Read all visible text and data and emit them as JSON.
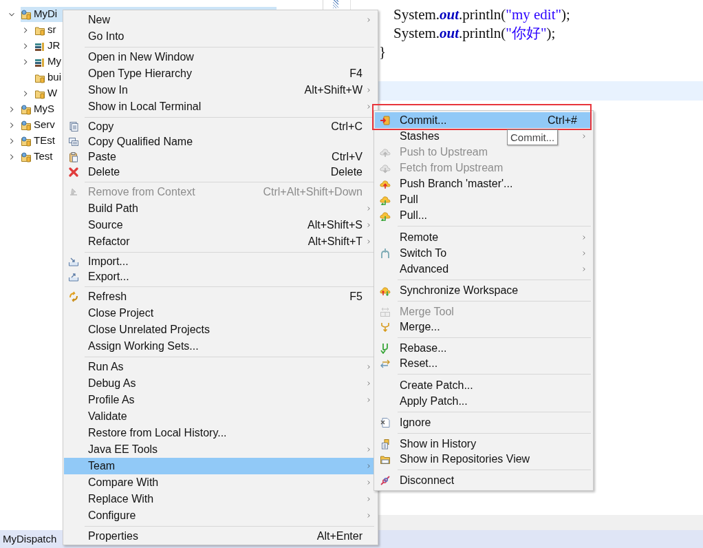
{
  "tree": {
    "items": [
      {
        "label": "MyDi",
        "expanded": true,
        "selected": true,
        "children": [
          {
            "label": "sr",
            "expanded": false,
            "selected": false
          },
          {
            "label": "JR",
            "expanded": false,
            "selected": false
          },
          {
            "label": "My",
            "expanded": false,
            "selected": false
          },
          {
            "label": "bui",
            "selected": false
          },
          {
            "label": "W",
            "expanded": false,
            "selected": false
          }
        ]
      },
      {
        "label": "MyS",
        "expanded": false,
        "selected": false
      },
      {
        "label": "Serv",
        "expanded": false,
        "selected": false
      },
      {
        "label": "TEst",
        "expanded": false,
        "selected": false
      },
      {
        "label": "Test",
        "expanded": false,
        "selected": false
      }
    ]
  },
  "editor": {
    "lines": [
      [
        {
          "kind": "plain",
          "text": "\tSystem."
        },
        {
          "kind": "field",
          "text": "out"
        },
        {
          "kind": "plain",
          "text": ".println("
        },
        {
          "kind": "string",
          "text": "\"my edit\""
        },
        {
          "kind": "plain",
          "text": ");"
        }
      ],
      [
        {
          "kind": "plain",
          "text": "\tSystem."
        },
        {
          "kind": "field",
          "text": "out"
        },
        {
          "kind": "plain",
          "text": ".println("
        },
        {
          "kind": "string",
          "text": "\"你好\""
        },
        {
          "kind": "plain",
          "text": ");"
        }
      ],
      [
        {
          "kind": "plain",
          "text": "}"
        }
      ]
    ]
  },
  "context_menu": {
    "groups": [
      [
        {
          "label": "New",
          "submenu": true,
          "disabled": false,
          "selected": false
        },
        {
          "label": "Go Into",
          "submenu": false,
          "disabled": false,
          "selected": false
        }
      ],
      [
        {
          "label": "Open in New Window",
          "submenu": false,
          "disabled": false,
          "selected": false
        },
        {
          "label": "Open Type Hierarchy",
          "shortcut": "F4",
          "submenu": false,
          "disabled": false,
          "selected": false
        },
        {
          "label": "Show In",
          "shortcut": "Alt+Shift+W",
          "submenu": true,
          "disabled": false,
          "selected": false
        },
        {
          "label": "Show in Local Terminal",
          "submenu": true,
          "disabled": false,
          "selected": false
        }
      ],
      [
        {
          "label": "Copy",
          "shortcut": "Ctrl+C",
          "submenu": false,
          "disabled": false,
          "selected": false
        },
        {
          "label": "Copy Qualified Name",
          "submenu": false,
          "disabled": false,
          "selected": false
        },
        {
          "label": "Paste",
          "shortcut": "Ctrl+V",
          "submenu": false,
          "disabled": false,
          "selected": false
        },
        {
          "label": "Delete",
          "shortcut": "Delete",
          "submenu": false,
          "disabled": false,
          "selected": false
        }
      ],
      [
        {
          "label": "Remove from Context",
          "shortcut": "Ctrl+Alt+Shift+Down",
          "submenu": false,
          "disabled": true,
          "selected": false
        },
        {
          "label": "Build Path",
          "submenu": true,
          "disabled": false,
          "selected": false
        },
        {
          "label": "Source",
          "shortcut": "Alt+Shift+S",
          "submenu": true,
          "disabled": false,
          "selected": false
        },
        {
          "label": "Refactor",
          "shortcut": "Alt+Shift+T",
          "submenu": true,
          "disabled": false,
          "selected": false
        }
      ],
      [
        {
          "label": "Import...",
          "submenu": false,
          "disabled": false,
          "selected": false
        },
        {
          "label": "Export...",
          "submenu": false,
          "disabled": false,
          "selected": false
        }
      ],
      [
        {
          "label": "Refresh",
          "shortcut": "F5",
          "submenu": false,
          "disabled": false,
          "selected": false
        },
        {
          "label": "Close Project",
          "submenu": false,
          "disabled": false,
          "selected": false
        },
        {
          "label": "Close Unrelated Projects",
          "submenu": false,
          "disabled": false,
          "selected": false
        },
        {
          "label": "Assign Working Sets...",
          "submenu": false,
          "disabled": false,
          "selected": false
        }
      ],
      [
        {
          "label": "Run As",
          "submenu": true,
          "disabled": false,
          "selected": false
        },
        {
          "label": "Debug As",
          "submenu": true,
          "disabled": false,
          "selected": false
        },
        {
          "label": "Profile As",
          "submenu": true,
          "disabled": false,
          "selected": false
        },
        {
          "label": "Validate",
          "submenu": false,
          "disabled": false,
          "selected": false
        },
        {
          "label": "Restore from Local History...",
          "submenu": false,
          "disabled": false,
          "selected": false
        },
        {
          "label": "Java EE Tools",
          "submenu": true,
          "disabled": false,
          "selected": false
        },
        {
          "label": "Team",
          "submenu": true,
          "disabled": false,
          "selected": true
        },
        {
          "label": "Compare With",
          "submenu": true,
          "disabled": false,
          "selected": false
        },
        {
          "label": "Replace With",
          "submenu": true,
          "disabled": false,
          "selected": false
        },
        {
          "label": "Configure",
          "submenu": true,
          "disabled": false,
          "selected": false
        }
      ],
      [
        {
          "label": "Properties",
          "shortcut": "Alt+Enter",
          "submenu": false,
          "disabled": false,
          "selected": false
        }
      ]
    ]
  },
  "team_submenu": {
    "groups": [
      [
        {
          "label": "Commit...",
          "shortcut": "Ctrl+#",
          "submenu": false,
          "disabled": false,
          "selected": true
        },
        {
          "label": "Stashes",
          "submenu": true,
          "disabled": false,
          "selected": false
        },
        {
          "label": "Push to Upstream",
          "submenu": false,
          "disabled": true,
          "selected": false
        },
        {
          "label": "Fetch from Upstream",
          "submenu": false,
          "disabled": true,
          "selected": false
        },
        {
          "label": "Push Branch 'master'...",
          "submenu": false,
          "disabled": false,
          "selected": false
        },
        {
          "label": "Pull",
          "submenu": false,
          "disabled": false,
          "selected": false
        },
        {
          "label": "Pull...",
          "submenu": false,
          "disabled": false,
          "selected": false
        }
      ],
      [
        {
          "label": "Remote",
          "submenu": true,
          "disabled": false,
          "selected": false
        },
        {
          "label": "Switch To",
          "submenu": true,
          "disabled": false,
          "selected": false
        },
        {
          "label": "Advanced",
          "submenu": true,
          "disabled": false,
          "selected": false
        }
      ],
      [
        {
          "label": "Synchronize Workspace",
          "submenu": false,
          "disabled": false,
          "selected": false
        }
      ],
      [
        {
          "label": "Merge Tool",
          "submenu": false,
          "disabled": true,
          "selected": false
        },
        {
          "label": "Merge...",
          "submenu": false,
          "disabled": false,
          "selected": false
        }
      ],
      [
        {
          "label": "Rebase...",
          "submenu": false,
          "disabled": false,
          "selected": false
        },
        {
          "label": "Reset...",
          "submenu": false,
          "disabled": false,
          "selected": false
        }
      ],
      [
        {
          "label": "Create Patch...",
          "submenu": false,
          "disabled": false,
          "selected": false
        },
        {
          "label": "Apply Patch...",
          "submenu": false,
          "disabled": false,
          "selected": false
        }
      ],
      [
        {
          "label": "Ignore",
          "submenu": false,
          "disabled": false,
          "selected": false
        }
      ],
      [
        {
          "label": "Show in History",
          "submenu": false,
          "disabled": false,
          "selected": false
        },
        {
          "label": "Show in Repositories View",
          "submenu": false,
          "disabled": false,
          "selected": false
        }
      ],
      [
        {
          "label": "Disconnect",
          "submenu": false,
          "disabled": false,
          "selected": false
        }
      ]
    ]
  },
  "tooltip": {
    "text": "Commit..."
  },
  "status_bar": {
    "text": "MyDispatch"
  }
}
